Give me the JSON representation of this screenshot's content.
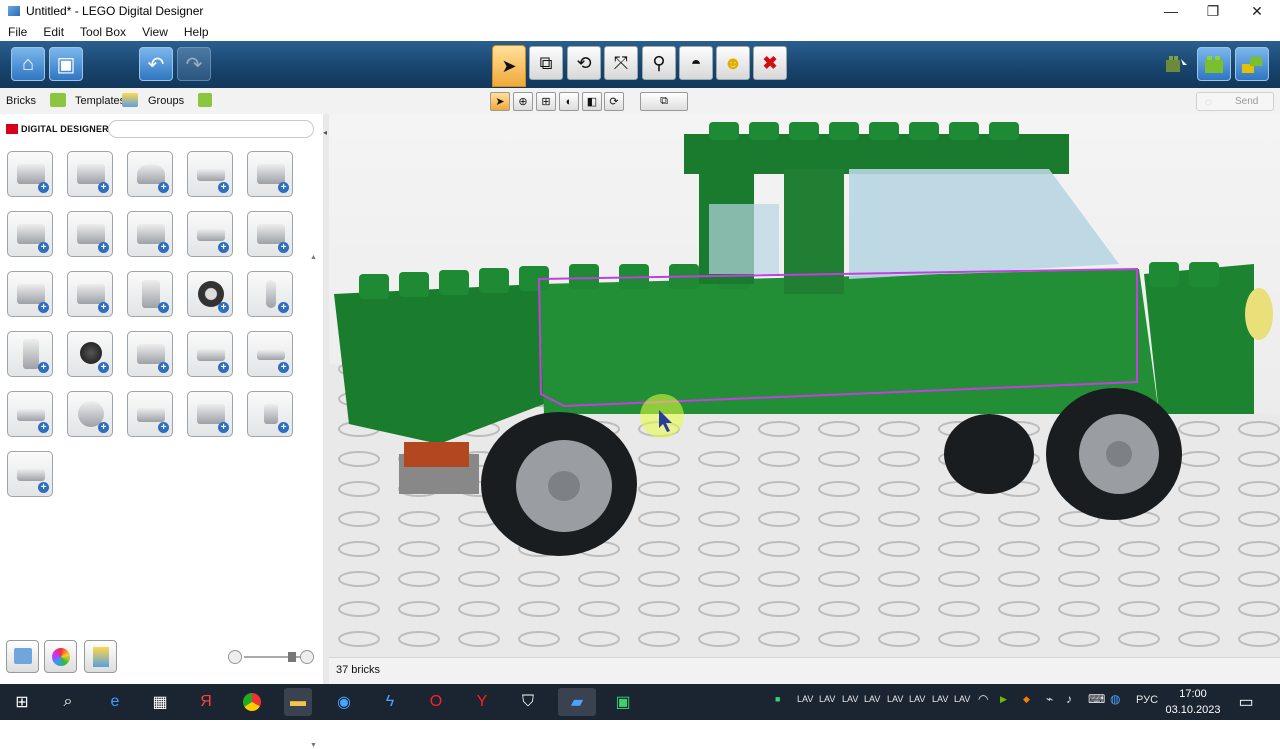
{
  "window": {
    "title": "Untitled* - LEGO Digital Designer",
    "minimize": "—",
    "restore": "❐",
    "close": "✕"
  },
  "menu": [
    "File",
    "Edit",
    "Tool Box",
    "View",
    "Help"
  ],
  "toolbar": {
    "send": "Send"
  },
  "tabs": {
    "bricks": "Bricks",
    "templates": "Templates",
    "groups": "Groups"
  },
  "brand": "DIGITAL DESIGNER",
  "status": {
    "bricks_count": "37 bricks"
  },
  "taskbar": {
    "lang": "РУС",
    "time": "17:00",
    "date": "03.10.2023",
    "tray_labels": [
      "LAV",
      "LAV",
      "LAV",
      "LAV",
      "LAV",
      "LAV",
      "LAV",
      "LAV"
    ]
  },
  "colors": {
    "toolbar_top": "#2a5f8f",
    "car_green": "#1f8a34",
    "taskbar": "#1b2431",
    "selection": "#c040e0"
  }
}
